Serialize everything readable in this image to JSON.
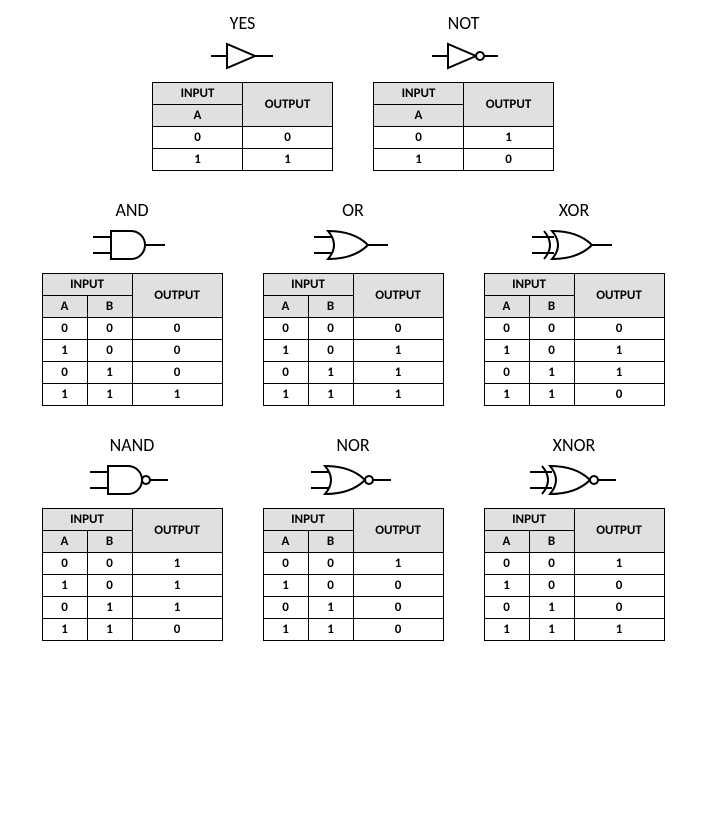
{
  "labels": {
    "input": "INPUT",
    "output": "OUTPUT",
    "a": "A",
    "b": "B"
  },
  "gates": {
    "yes": {
      "title": "YES",
      "inputs": 1,
      "rows": [
        [
          0,
          0
        ],
        [
          1,
          1
        ]
      ]
    },
    "not": {
      "title": "NOT",
      "inputs": 1,
      "rows": [
        [
          0,
          1
        ],
        [
          1,
          0
        ]
      ]
    },
    "and": {
      "title": "AND",
      "inputs": 2,
      "rows": [
        [
          0,
          0,
          0
        ],
        [
          1,
          0,
          0
        ],
        [
          0,
          1,
          0
        ],
        [
          1,
          1,
          1
        ]
      ]
    },
    "or": {
      "title": "OR",
      "inputs": 2,
      "rows": [
        [
          0,
          0,
          0
        ],
        [
          1,
          0,
          1
        ],
        [
          0,
          1,
          1
        ],
        [
          1,
          1,
          1
        ]
      ]
    },
    "xor": {
      "title": "XOR",
      "inputs": 2,
      "rows": [
        [
          0,
          0,
          0
        ],
        [
          1,
          0,
          1
        ],
        [
          0,
          1,
          1
        ],
        [
          1,
          1,
          0
        ]
      ]
    },
    "nand": {
      "title": "NAND",
      "inputs": 2,
      "rows": [
        [
          0,
          0,
          1
        ],
        [
          1,
          0,
          1
        ],
        [
          0,
          1,
          1
        ],
        [
          1,
          1,
          0
        ]
      ]
    },
    "nor": {
      "title": "NOR",
      "inputs": 2,
      "rows": [
        [
          0,
          0,
          1
        ],
        [
          1,
          0,
          0
        ],
        [
          0,
          1,
          0
        ],
        [
          1,
          1,
          0
        ]
      ]
    },
    "xnor": {
      "title": "XNOR",
      "inputs": 2,
      "rows": [
        [
          0,
          0,
          1
        ],
        [
          1,
          0,
          0
        ],
        [
          0,
          1,
          0
        ],
        [
          1,
          1,
          1
        ]
      ]
    }
  }
}
